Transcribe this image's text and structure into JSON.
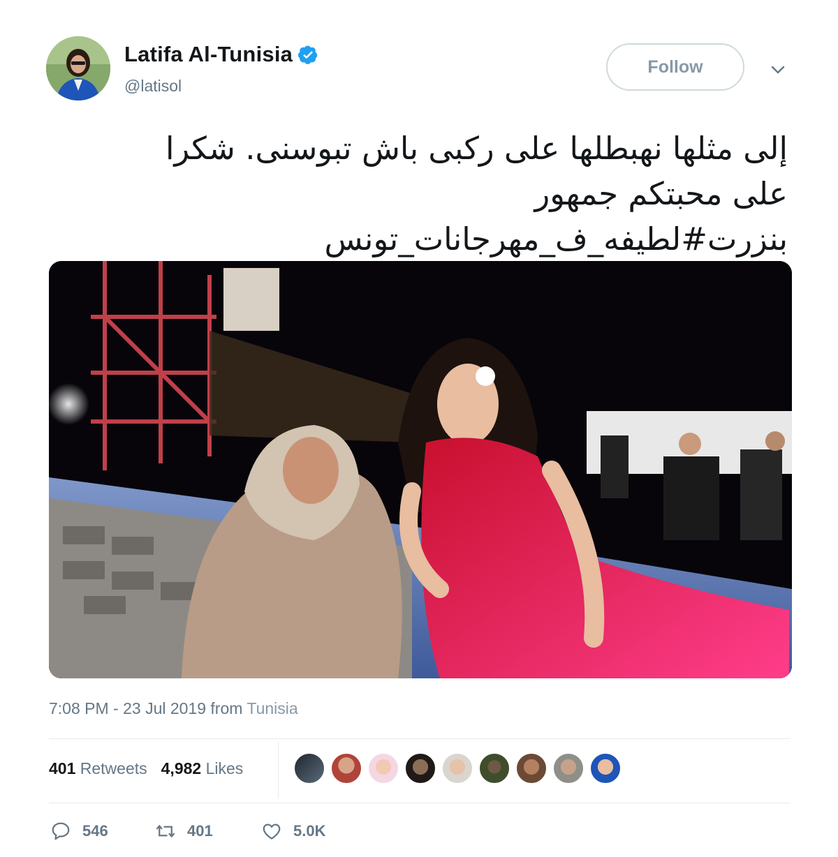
{
  "user": {
    "display_name": "Latifa Al-Tunisia",
    "handle": "@latisol",
    "verified": true,
    "follow_label": "Follow"
  },
  "tweet": {
    "text_lines": [
      "إلى مثلها نهبطلها على ركبى باش تبوسنى. شكرا",
      "على محبتكم جمهور",
      "بنزرت#لطيفه_ف_مهرجانات_تونس"
    ],
    "time": "7:08 PM - 23 Jul 2019",
    "from_label": "from",
    "location": "Tunisia"
  },
  "stats": {
    "retweets_count": "401",
    "retweets_label": "Retweets",
    "likes_count": "4,982",
    "likes_label": "Likes"
  },
  "actions": {
    "replies": "546",
    "retweets": "401",
    "likes": "5.0K"
  },
  "colors": {
    "verified_blue": "#1da1f2",
    "secondary_text": "#657786",
    "dress_pink": "#e0245e"
  }
}
